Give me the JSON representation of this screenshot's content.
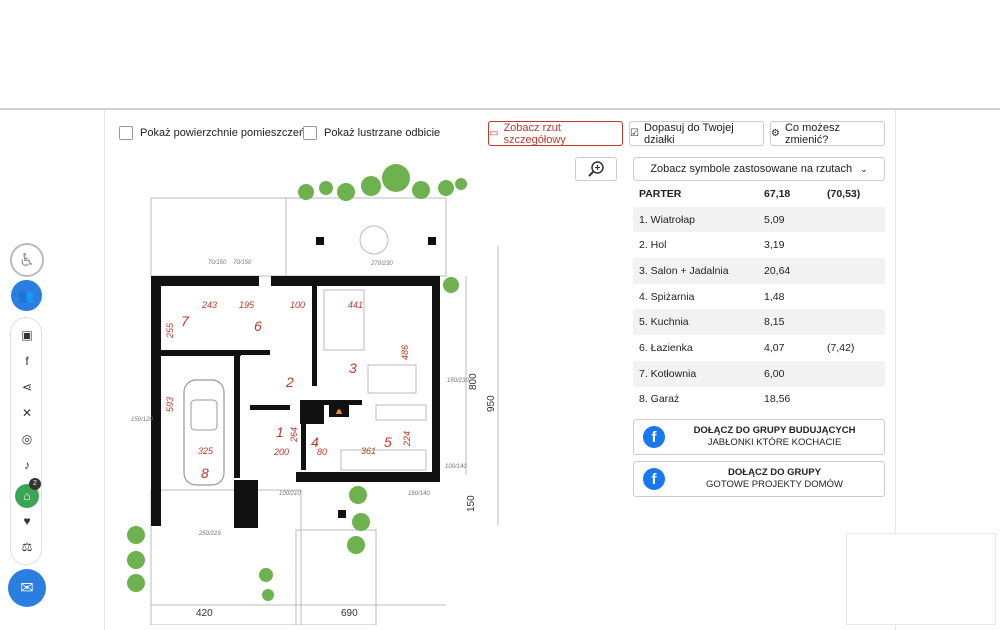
{
  "controls": {
    "show_areas_label": "Pokaż powierzchnie pomieszczeń",
    "mirror_label": "Pokaż lustrzane odbicie",
    "detailed_plan_label": "Zobacz rzut szczegółowy",
    "fit_plot_label": "Dopasuj do Twojej działki",
    "what_change_label": "Co możesz zmienić?",
    "symbols_label": "Zobacz symbole zastosowane na rzutach"
  },
  "rooms_table": {
    "header": {
      "name": "PARTER",
      "area": "67,18",
      "extra": "(70,53)"
    },
    "rows": [
      {
        "name": "1. Wiatrołap",
        "area": "5,09",
        "extra": ""
      },
      {
        "name": "2. Hol",
        "area": "3,19",
        "extra": ""
      },
      {
        "name": "3. Salon + Jadalnia",
        "area": "20,64",
        "extra": ""
      },
      {
        "name": "4. Spiżarnia",
        "area": "1,48",
        "extra": ""
      },
      {
        "name": "5. Kuchnia",
        "area": "8,15",
        "extra": ""
      },
      {
        "name": "6. Łazienka",
        "area": "4,07",
        "extra": "(7,42)"
      },
      {
        "name": "7. Kotłownia",
        "area": "6,00",
        "extra": ""
      },
      {
        "name": "8. Garaż",
        "area": "18,56",
        "extra": ""
      }
    ]
  },
  "facebook_groups": [
    {
      "line1": "DOŁĄCZ DO GRUPY BUDUJĄCYCH",
      "line2": "JABŁONKI KTÓRE KOCHACIE"
    },
    {
      "line1": "DOŁĄCZ DO GRUPY",
      "line2": "GOTOWE PROJEKTY DOMÓW"
    }
  ],
  "plan": {
    "dims": {
      "left_width": "420",
      "right_width": "690",
      "height_total": "950",
      "height_house": "800",
      "height_bottom": "150"
    },
    "room_numbers": [
      "1",
      "2",
      "3",
      "4",
      "5",
      "6",
      "7",
      "8"
    ],
    "labels": {
      "d243": "243",
      "d195": "195",
      "d100": "100",
      "d441": "441",
      "d255": "255",
      "d593": "593",
      "d486": "486",
      "d325": "325",
      "d200": "200",
      "d361": "361",
      "d224": "224",
      "d80": "80",
      "d264": "264",
      "w_70_150a": "70/150",
      "w_70_150b": "70/150",
      "w_270_230": "270/230",
      "w_150_120": "150/120",
      "w_150_230": "150/230",
      "w_100_140": "100/140",
      "w_100_210": "100/210",
      "w_160_140": "160/140",
      "w_250_229": "250/229"
    }
  },
  "sidebar": {
    "notif_badge": "2"
  },
  "colors": {
    "accent_red": "#c0392b",
    "facebook_blue": "#1877f2",
    "wall": "#111111",
    "room_number_red": "#c0392b",
    "accent_blue": "#2a7de1",
    "green": "#3aa655"
  }
}
